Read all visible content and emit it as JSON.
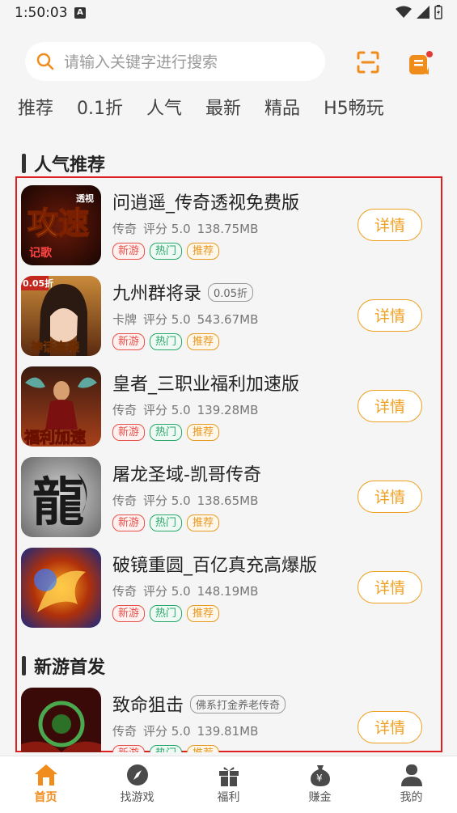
{
  "status": {
    "time": "1:50:03",
    "notif": "A"
  },
  "search": {
    "placeholder": "请输入关键字进行搜索"
  },
  "tabs": [
    "推荐",
    "0.1折",
    "人气",
    "最新",
    "精品",
    "H5畅玩"
  ],
  "sections": {
    "popular": "人气推荐",
    "new": "新游首发"
  },
  "games": [
    {
      "name": "问逍遥_传奇透视免费版",
      "tag": "",
      "category": "传奇",
      "rating": "评分 5.0",
      "size": "138.75MB",
      "tags": [
        "新游",
        "热门",
        "推荐"
      ],
      "detail": "详情"
    },
    {
      "name": "九州群将录",
      "tag": "0.05折",
      "category": "卡牌",
      "rating": "评分 5.0",
      "size": "543.67MB",
      "tags": [
        "新游",
        "热门",
        "推荐"
      ],
      "detail": "详情"
    },
    {
      "name": "皇者_三职业福利加速版",
      "tag": "",
      "category": "传奇",
      "rating": "评分 5.0",
      "size": "139.28MB",
      "tags": [
        "新游",
        "热门",
        "推荐"
      ],
      "detail": "详情"
    },
    {
      "name": "屠龙圣域-凯哥传奇",
      "tag": "",
      "category": "传奇",
      "rating": "评分 5.0",
      "size": "138.65MB",
      "tags": [
        "新游",
        "热门",
        "推荐"
      ],
      "detail": "详情"
    },
    {
      "name": "破镜重圆_百亿真充高爆版",
      "tag": "",
      "category": "传奇",
      "rating": "评分 5.0",
      "size": "148.19MB",
      "tags": [
        "新游",
        "热门",
        "推荐"
      ],
      "detail": "详情"
    },
    {
      "name": "致命狙击",
      "tag": "佛系打金养老传奇",
      "category": "传奇",
      "rating": "评分 5.0",
      "size": "139.81MB",
      "tags": [
        "新游",
        "热门",
        "推荐"
      ],
      "detail": "详情"
    }
  ],
  "game_icon_texts": {
    "g0_main": "攻速",
    "g0_side": "透视",
    "g0_bottom": "记歌",
    "g1_badge": "0.05折",
    "g1_bottom": "神话来袭",
    "g2_bottom": "福利加速",
    "g3_char": "龍"
  },
  "nav": [
    {
      "label": "首页",
      "icon": "home-icon",
      "active": true
    },
    {
      "label": "找游戏",
      "icon": "compass-icon",
      "active": false
    },
    {
      "label": "福利",
      "icon": "gift-icon",
      "active": false
    },
    {
      "label": "赚金",
      "icon": "money-bag-icon",
      "active": false
    },
    {
      "label": "我的",
      "icon": "user-icon",
      "active": false
    }
  ],
  "colors": {
    "accent": "#f08c1c",
    "frame": "#e02020",
    "tag_new": "#e8504a",
    "tag_hot": "#29a86a",
    "tag_rec": "#e69a24"
  }
}
